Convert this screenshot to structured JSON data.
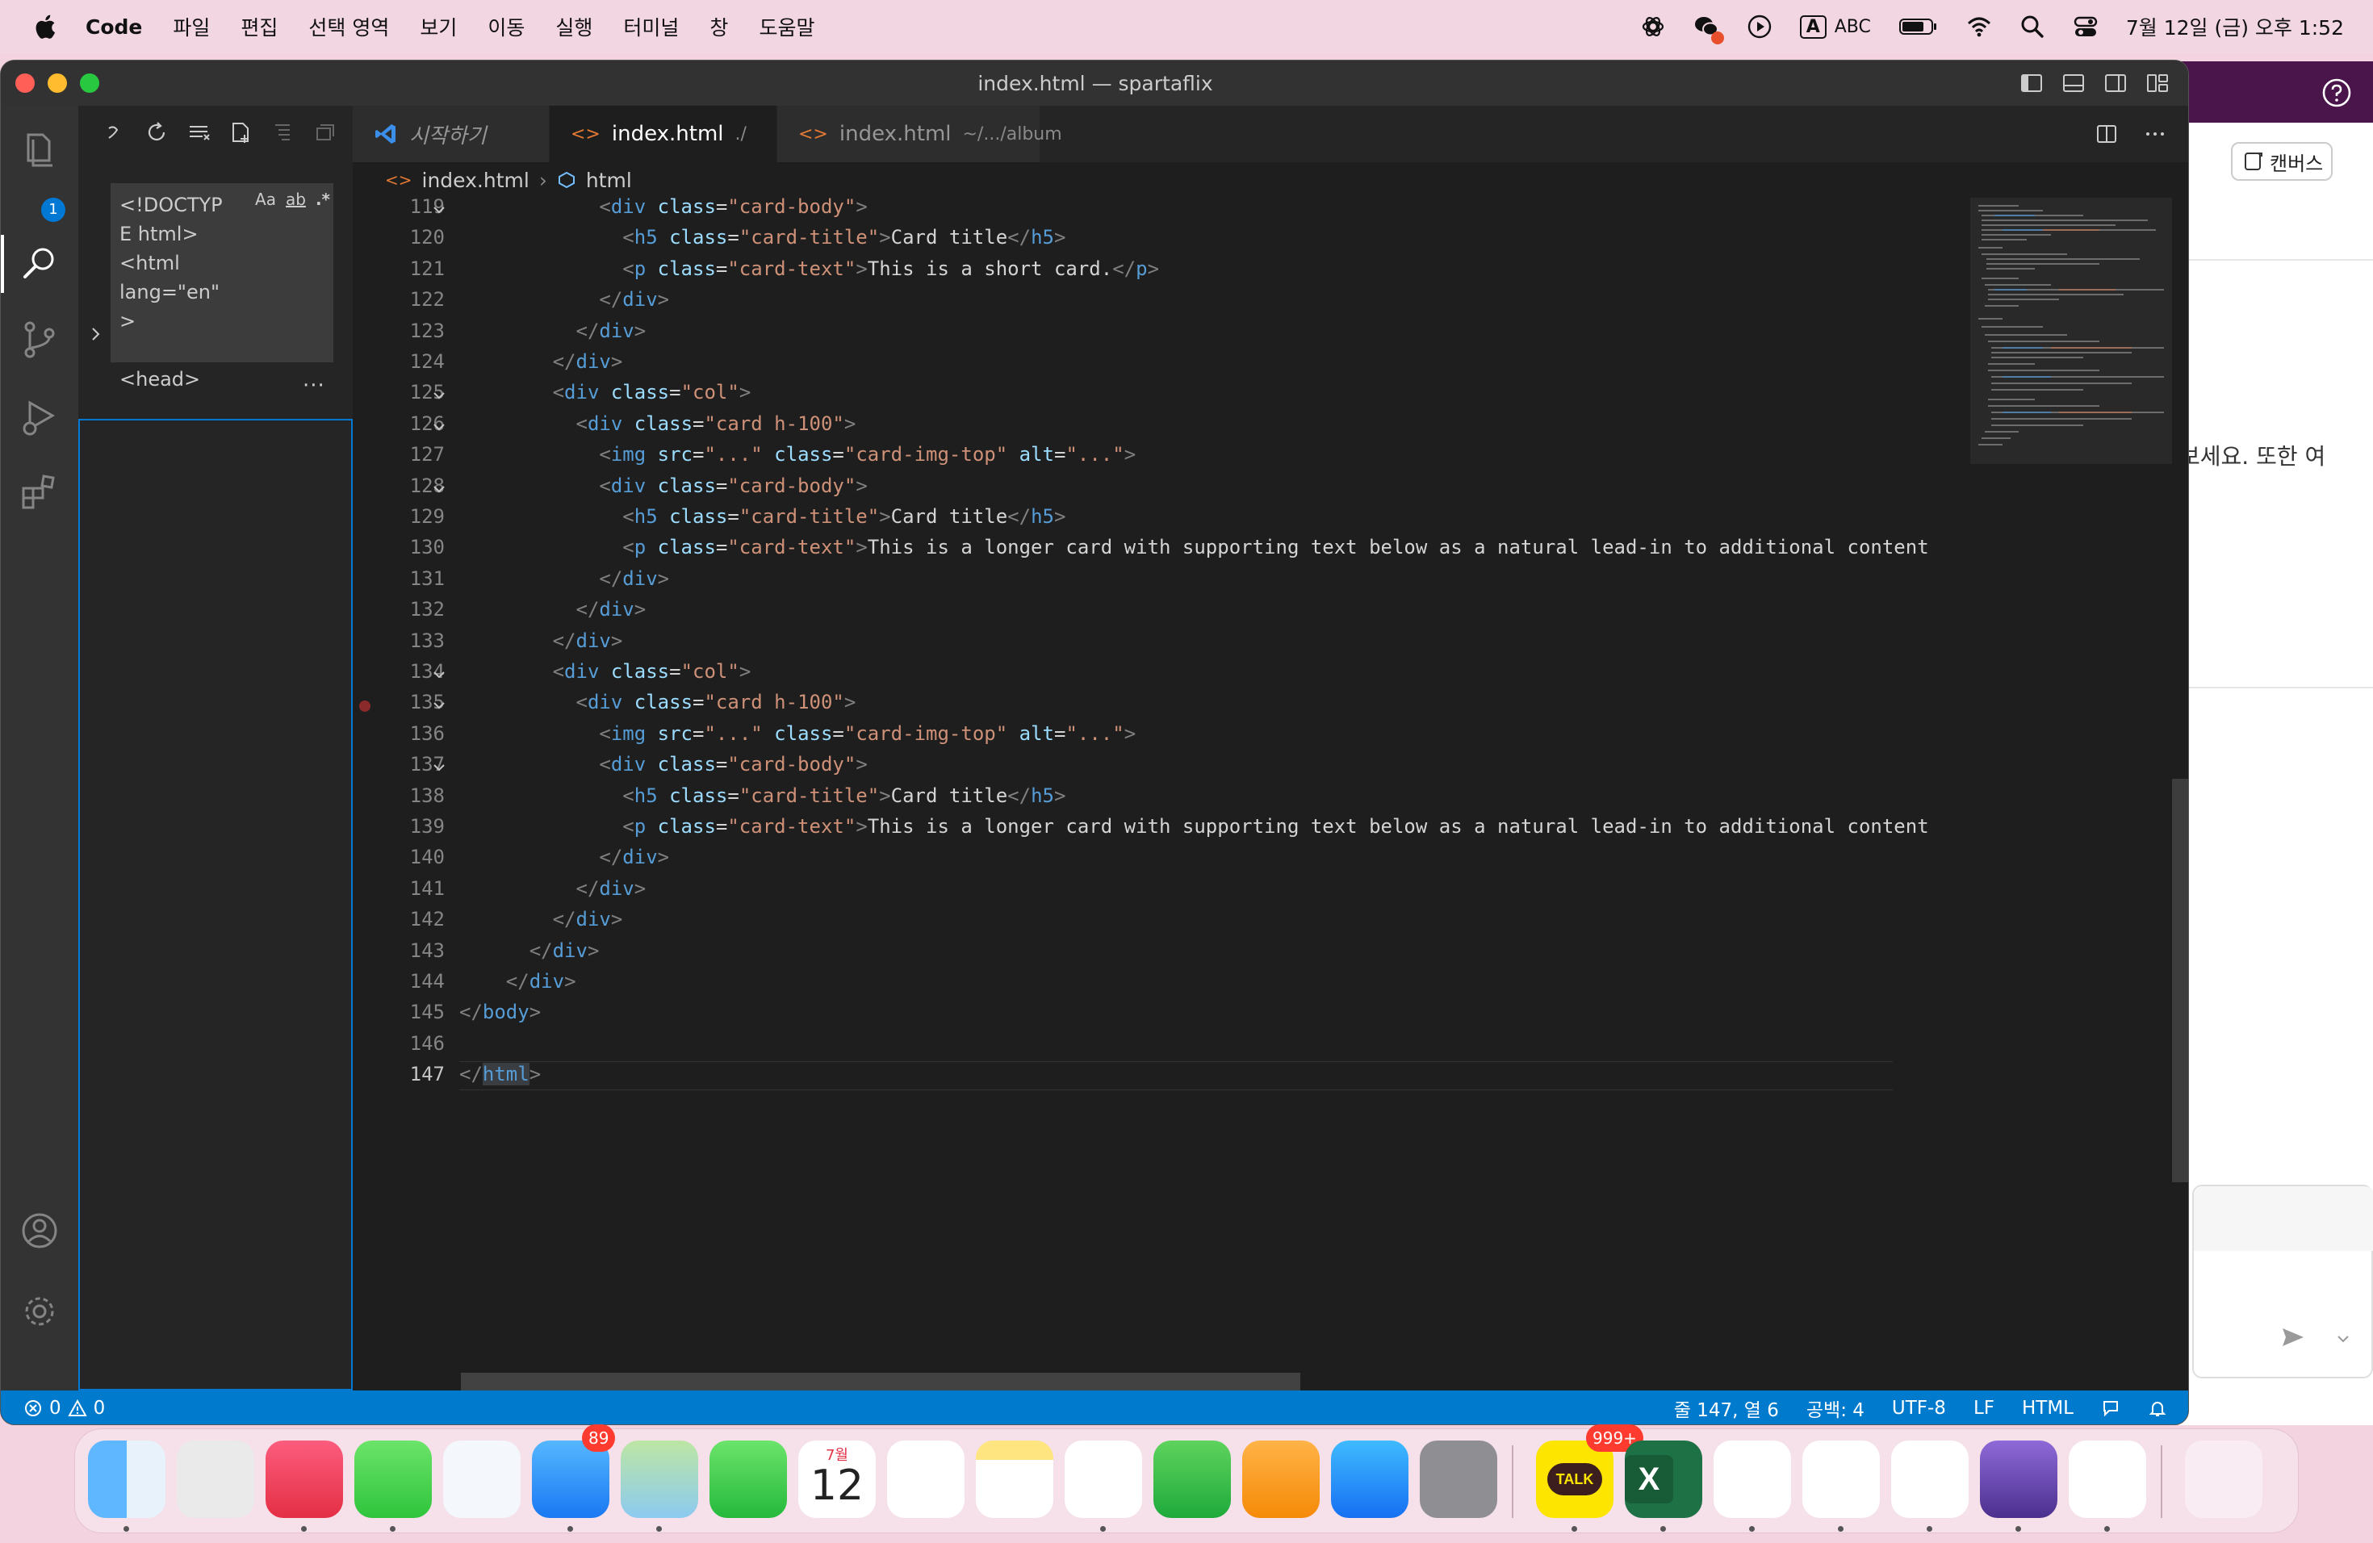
{
  "menubar": {
    "app_name": "Code",
    "menus": [
      "파일",
      "편집",
      "선택 영역",
      "보기",
      "이동",
      "실행",
      "터미널",
      "창",
      "도움말"
    ],
    "input_label": "A",
    "input_source": "ABC",
    "datetime": "7월 12일 (금) 오후 1:52",
    "icons": [
      "chatgpt-icon",
      "wechat-icon",
      "play-icon",
      "input-source-icon",
      "battery-icon",
      "wifi-icon",
      "spotlight-icon",
      "control-center-icon"
    ]
  },
  "window": {
    "title": "index.html — spartaflix"
  },
  "activity": {
    "explorer_badge": "1",
    "items": [
      "explorer-icon",
      "search-icon",
      "source-control-icon",
      "run-debug-icon",
      "extensions-icon",
      "accounts-icon",
      "settings-icon"
    ]
  },
  "sidebar": {
    "search_text": "<!DOCTYP\nE html>\n<html\nlang=\"en\"\n>\n\n<head>",
    "opt_case": "Aa",
    "opt_word": "ab",
    "opt_regex": ".*",
    "more": "···"
  },
  "tabs": [
    {
      "label": "시작하기",
      "sub": ""
    },
    {
      "label": "index.html",
      "sub": "./"
    },
    {
      "label": "index.html",
      "sub": "~/.../album"
    }
  ],
  "breadcrumb": {
    "file": "index.html",
    "symbol": "html"
  },
  "editor": {
    "lines": [
      {
        "n": "119",
        "fold": true,
        "bp": false,
        "segs": [
          [
            "x",
            "            "
          ],
          [
            "p",
            "<"
          ],
          [
            "t",
            "div"
          ],
          [
            "x",
            " "
          ],
          [
            "a",
            "class"
          ],
          [
            "x",
            "="
          ],
          [
            "s",
            "\"card-body\""
          ],
          [
            "p",
            ">"
          ]
        ]
      },
      {
        "n": "120",
        "fold": false,
        "bp": false,
        "segs": [
          [
            "x",
            "              "
          ],
          [
            "p",
            "<"
          ],
          [
            "t",
            "h5"
          ],
          [
            "x",
            " "
          ],
          [
            "a",
            "class"
          ],
          [
            "x",
            "="
          ],
          [
            "s",
            "\"card-title\""
          ],
          [
            "p",
            ">"
          ],
          [
            "x",
            "Card title"
          ],
          [
            "p",
            "</"
          ],
          [
            "t",
            "h5"
          ],
          [
            "p",
            ">"
          ]
        ]
      },
      {
        "n": "121",
        "fold": false,
        "bp": false,
        "segs": [
          [
            "x",
            "              "
          ],
          [
            "p",
            "<"
          ],
          [
            "t",
            "p"
          ],
          [
            "x",
            " "
          ],
          [
            "a",
            "class"
          ],
          [
            "x",
            "="
          ],
          [
            "s",
            "\"card-text\""
          ],
          [
            "p",
            ">"
          ],
          [
            "x",
            "This is a short card."
          ],
          [
            "p",
            "</"
          ],
          [
            "t",
            "p"
          ],
          [
            "p",
            ">"
          ]
        ]
      },
      {
        "n": "122",
        "fold": false,
        "bp": false,
        "segs": [
          [
            "x",
            "            "
          ],
          [
            "p",
            "</"
          ],
          [
            "t",
            "div"
          ],
          [
            "p",
            ">"
          ]
        ]
      },
      {
        "n": "123",
        "fold": false,
        "bp": false,
        "segs": [
          [
            "x",
            "          "
          ],
          [
            "p",
            "</"
          ],
          [
            "t",
            "div"
          ],
          [
            "p",
            ">"
          ]
        ]
      },
      {
        "n": "124",
        "fold": false,
        "bp": false,
        "segs": [
          [
            "x",
            "        "
          ],
          [
            "p",
            "</"
          ],
          [
            "t",
            "div"
          ],
          [
            "p",
            ">"
          ]
        ]
      },
      {
        "n": "125",
        "fold": true,
        "bp": false,
        "segs": [
          [
            "x",
            "        "
          ],
          [
            "p",
            "<"
          ],
          [
            "t",
            "div"
          ],
          [
            "x",
            " "
          ],
          [
            "a",
            "class"
          ],
          [
            "x",
            "="
          ],
          [
            "s",
            "\"col\""
          ],
          [
            "p",
            ">"
          ]
        ]
      },
      {
        "n": "126",
        "fold": true,
        "bp": false,
        "segs": [
          [
            "x",
            "          "
          ],
          [
            "p",
            "<"
          ],
          [
            "t",
            "div"
          ],
          [
            "x",
            " "
          ],
          [
            "a",
            "class"
          ],
          [
            "x",
            "="
          ],
          [
            "s",
            "\"card h-100\""
          ],
          [
            "p",
            ">"
          ]
        ]
      },
      {
        "n": "127",
        "fold": false,
        "bp": false,
        "segs": [
          [
            "x",
            "            "
          ],
          [
            "p",
            "<"
          ],
          [
            "t",
            "img"
          ],
          [
            "x",
            " "
          ],
          [
            "a",
            "src"
          ],
          [
            "x",
            "="
          ],
          [
            "s",
            "\"...\""
          ],
          [
            "x",
            " "
          ],
          [
            "a",
            "class"
          ],
          [
            "x",
            "="
          ],
          [
            "s",
            "\"card-img-top\""
          ],
          [
            "x",
            " "
          ],
          [
            "a",
            "alt"
          ],
          [
            "x",
            "="
          ],
          [
            "s",
            "\"...\""
          ],
          [
            "p",
            ">"
          ]
        ]
      },
      {
        "n": "128",
        "fold": true,
        "bp": false,
        "segs": [
          [
            "x",
            "            "
          ],
          [
            "p",
            "<"
          ],
          [
            "t",
            "div"
          ],
          [
            "x",
            " "
          ],
          [
            "a",
            "class"
          ],
          [
            "x",
            "="
          ],
          [
            "s",
            "\"card-body\""
          ],
          [
            "p",
            ">"
          ]
        ]
      },
      {
        "n": "129",
        "fold": false,
        "bp": false,
        "segs": [
          [
            "x",
            "              "
          ],
          [
            "p",
            "<"
          ],
          [
            "t",
            "h5"
          ],
          [
            "x",
            " "
          ],
          [
            "a",
            "class"
          ],
          [
            "x",
            "="
          ],
          [
            "s",
            "\"card-title\""
          ],
          [
            "p",
            ">"
          ],
          [
            "x",
            "Card title"
          ],
          [
            "p",
            "</"
          ],
          [
            "t",
            "h5"
          ],
          [
            "p",
            ">"
          ]
        ]
      },
      {
        "n": "130",
        "fold": false,
        "bp": false,
        "segs": [
          [
            "x",
            "              "
          ],
          [
            "p",
            "<"
          ],
          [
            "t",
            "p"
          ],
          [
            "x",
            " "
          ],
          [
            "a",
            "class"
          ],
          [
            "x",
            "="
          ],
          [
            "s",
            "\"card-text\""
          ],
          [
            "p",
            ">"
          ],
          [
            "x",
            "This is a longer card with supporting text below as a natural lead-in to additional content"
          ]
        ]
      },
      {
        "n": "131",
        "fold": false,
        "bp": false,
        "segs": [
          [
            "x",
            "            "
          ],
          [
            "p",
            "</"
          ],
          [
            "t",
            "div"
          ],
          [
            "p",
            ">"
          ]
        ]
      },
      {
        "n": "132",
        "fold": false,
        "bp": false,
        "segs": [
          [
            "x",
            "          "
          ],
          [
            "p",
            "</"
          ],
          [
            "t",
            "div"
          ],
          [
            "p",
            ">"
          ]
        ]
      },
      {
        "n": "133",
        "fold": false,
        "bp": false,
        "segs": [
          [
            "x",
            "        "
          ],
          [
            "p",
            "</"
          ],
          [
            "t",
            "div"
          ],
          [
            "p",
            ">"
          ]
        ]
      },
      {
        "n": "134",
        "fold": true,
        "bp": false,
        "segs": [
          [
            "x",
            "        "
          ],
          [
            "p",
            "<"
          ],
          [
            "t",
            "div"
          ],
          [
            "x",
            " "
          ],
          [
            "a",
            "class"
          ],
          [
            "x",
            "="
          ],
          [
            "s",
            "\"col\""
          ],
          [
            "p",
            ">"
          ]
        ]
      },
      {
        "n": "135",
        "fold": true,
        "bp": true,
        "segs": [
          [
            "x",
            "          "
          ],
          [
            "p",
            "<"
          ],
          [
            "t",
            "div"
          ],
          [
            "x",
            " "
          ],
          [
            "a",
            "class"
          ],
          [
            "x",
            "="
          ],
          [
            "s",
            "\"card h-100\""
          ],
          [
            "p",
            ">"
          ]
        ]
      },
      {
        "n": "136",
        "fold": false,
        "bp": false,
        "segs": [
          [
            "x",
            "            "
          ],
          [
            "p",
            "<"
          ],
          [
            "t",
            "img"
          ],
          [
            "x",
            " "
          ],
          [
            "a",
            "src"
          ],
          [
            "x",
            "="
          ],
          [
            "s",
            "\"...\""
          ],
          [
            "x",
            " "
          ],
          [
            "a",
            "class"
          ],
          [
            "x",
            "="
          ],
          [
            "s",
            "\"card-img-top\""
          ],
          [
            "x",
            " "
          ],
          [
            "a",
            "alt"
          ],
          [
            "x",
            "="
          ],
          [
            "s",
            "\"...\""
          ],
          [
            "p",
            ">"
          ]
        ]
      },
      {
        "n": "137",
        "fold": true,
        "bp": false,
        "segs": [
          [
            "x",
            "            "
          ],
          [
            "p",
            "<"
          ],
          [
            "t",
            "div"
          ],
          [
            "x",
            " "
          ],
          [
            "a",
            "class"
          ],
          [
            "x",
            "="
          ],
          [
            "s",
            "\"card-body\""
          ],
          [
            "p",
            ">"
          ]
        ]
      },
      {
        "n": "138",
        "fold": false,
        "bp": false,
        "segs": [
          [
            "x",
            "              "
          ],
          [
            "p",
            "<"
          ],
          [
            "t",
            "h5"
          ],
          [
            "x",
            " "
          ],
          [
            "a",
            "class"
          ],
          [
            "x",
            "="
          ],
          [
            "s",
            "\"card-title\""
          ],
          [
            "p",
            ">"
          ],
          [
            "x",
            "Card title"
          ],
          [
            "p",
            "</"
          ],
          [
            "t",
            "h5"
          ],
          [
            "p",
            ">"
          ]
        ]
      },
      {
        "n": "139",
        "fold": false,
        "bp": false,
        "segs": [
          [
            "x",
            "              "
          ],
          [
            "p",
            "<"
          ],
          [
            "t",
            "p"
          ],
          [
            "x",
            " "
          ],
          [
            "a",
            "class"
          ],
          [
            "x",
            "="
          ],
          [
            "s",
            "\"card-text\""
          ],
          [
            "p",
            ">"
          ],
          [
            "x",
            "This is a longer card with supporting text below as a natural lead-in to additional content"
          ]
        ]
      },
      {
        "n": "140",
        "fold": false,
        "bp": false,
        "segs": [
          [
            "x",
            "            "
          ],
          [
            "p",
            "</"
          ],
          [
            "t",
            "div"
          ],
          [
            "p",
            ">"
          ]
        ]
      },
      {
        "n": "141",
        "fold": false,
        "bp": false,
        "segs": [
          [
            "x",
            "          "
          ],
          [
            "p",
            "</"
          ],
          [
            "t",
            "div"
          ],
          [
            "p",
            ">"
          ]
        ]
      },
      {
        "n": "142",
        "fold": false,
        "bp": false,
        "segs": [
          [
            "x",
            "        "
          ],
          [
            "p",
            "</"
          ],
          [
            "t",
            "div"
          ],
          [
            "p",
            ">"
          ]
        ]
      },
      {
        "n": "143",
        "fold": false,
        "bp": false,
        "segs": [
          [
            "x",
            "      "
          ],
          [
            "p",
            "</"
          ],
          [
            "t",
            "div"
          ],
          [
            "p",
            ">"
          ]
        ]
      },
      {
        "n": "144",
        "fold": false,
        "bp": false,
        "segs": [
          [
            "x",
            "    "
          ],
          [
            "p",
            "</"
          ],
          [
            "t",
            "div"
          ],
          [
            "p",
            ">"
          ]
        ]
      },
      {
        "n": "145",
        "fold": false,
        "bp": false,
        "segs": [
          [
            "p",
            "</"
          ],
          [
            "t",
            "body"
          ],
          [
            "p",
            ">"
          ]
        ]
      },
      {
        "n": "146",
        "fold": false,
        "bp": false,
        "segs": []
      },
      {
        "n": "147",
        "fold": false,
        "bp": false,
        "segs": [
          [
            "p",
            "</"
          ],
          [
            "t",
            "html"
          ],
          [
            "p",
            ">"
          ]
        ]
      }
    ],
    "current_line": "147"
  },
  "statusbar": {
    "errors": "0",
    "warnings": "0",
    "position": "줄 147, 열 6",
    "spaces": "공백: 4",
    "encoding": "UTF-8",
    "eol": "LF",
    "language": "HTML"
  },
  "bgapp": {
    "canvas_label": "캔버스",
    "partial_text": "보세요. 또한 여"
  },
  "dock": {
    "apps": [
      {
        "name": "finder",
        "badge": ""
      },
      {
        "name": "launchpad",
        "badge": ""
      },
      {
        "name": "music",
        "badge": ""
      },
      {
        "name": "messages",
        "badge": ""
      },
      {
        "name": "safari",
        "badge": ""
      },
      {
        "name": "mail",
        "badge": "89"
      },
      {
        "name": "maps",
        "badge": ""
      },
      {
        "name": "facetime",
        "badge": ""
      },
      {
        "name": "calendar",
        "badge": "",
        "month": "7월",
        "day": "12"
      },
      {
        "name": "reminders",
        "badge": ""
      },
      {
        "name": "notes",
        "badge": ""
      },
      {
        "name": "freeform",
        "badge": ""
      },
      {
        "name": "numbers",
        "badge": ""
      },
      {
        "name": "pages",
        "badge": ""
      },
      {
        "name": "app-store",
        "badge": ""
      },
      {
        "name": "system-settings",
        "badge": ""
      },
      {
        "name": "kakaotalk",
        "badge": "999+",
        "label": "TALK"
      },
      {
        "name": "excel",
        "badge": ""
      },
      {
        "name": "chatgpt",
        "badge": ""
      },
      {
        "name": "chrome",
        "badge": ""
      },
      {
        "name": "slack",
        "badge": ""
      },
      {
        "name": "obsidian",
        "badge": ""
      },
      {
        "name": "vscode",
        "badge": ""
      },
      {
        "name": "trash",
        "badge": ""
      }
    ]
  }
}
